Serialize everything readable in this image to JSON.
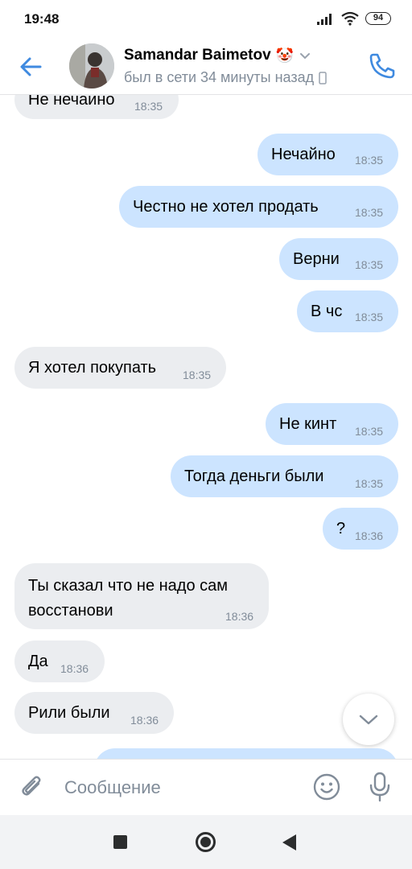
{
  "status_bar": {
    "time": "19:48",
    "battery": "94"
  },
  "header": {
    "contact_name": "Samandar Baimetov",
    "name_emoji": "🤡",
    "status": "был в сети 34 минуты назад"
  },
  "messages": [
    {
      "dir": "in",
      "text": "Не нечайно",
      "time": "18:35"
    },
    {
      "dir": "out",
      "text": "Нечайно",
      "time": "18:35"
    },
    {
      "dir": "out",
      "text": "Честно не хотел продать",
      "time": "18:35"
    },
    {
      "dir": "out",
      "text": "Верни",
      "time": "18:35"
    },
    {
      "dir": "out",
      "text": "В чс",
      "time": "18:35"
    },
    {
      "dir": "in",
      "text": "Я хотел покупать",
      "time": "18:35"
    },
    {
      "dir": "out",
      "text": "Не кинт",
      "time": "18:35"
    },
    {
      "dir": "out",
      "text": "Тогда деньги были",
      "time": "18:35"
    },
    {
      "dir": "out",
      "text": "?",
      "time": "18:36"
    },
    {
      "dir": "in",
      "text": "Ты сказал что не надо сам\nвосстанови",
      "time": "18:36"
    },
    {
      "dir": "in",
      "text": "Да",
      "time": "18:36"
    },
    {
      "dir": "in",
      "text": "Рили были",
      "time": "18:36"
    },
    {
      "dir": "out",
      "text": "",
      "time": ""
    }
  ],
  "composer": {
    "placeholder": "Сообщение"
  },
  "icons": {
    "back": "arrow-left-icon",
    "call": "phone-icon",
    "attach": "paperclip-icon",
    "emoji": "smile-icon",
    "mic": "microphone-icon",
    "scroll": "chevron-down-icon"
  },
  "colors": {
    "accent": "#3f8ae0",
    "incoming_bubble": "#ebedf0",
    "outgoing_bubble": "#cce4ff",
    "secondary_text": "#818c99"
  }
}
